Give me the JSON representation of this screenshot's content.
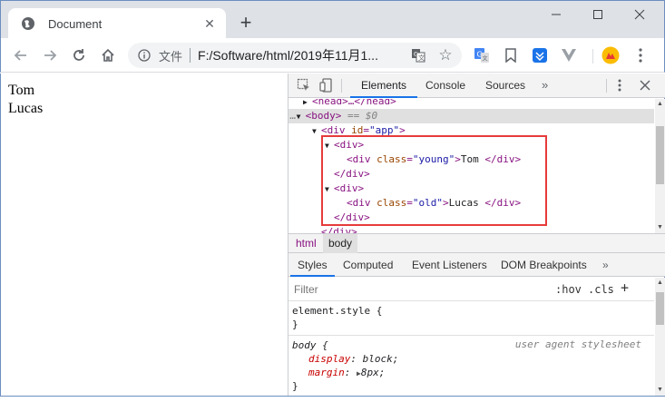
{
  "browser": {
    "tab_title": "Document",
    "new_tab_label": "+",
    "site_label": "文件",
    "url": "F:/Software/html/2019年11月1...",
    "icons": {
      "favicon": "globe-icon",
      "back": "back-arrow-icon",
      "forward": "forward-arrow-icon",
      "reload": "reload-icon",
      "home": "home-icon",
      "info": "info-icon",
      "translate": "translate-icon",
      "star": "star-icon",
      "menu": "kebab-menu-icon"
    }
  },
  "page": {
    "lines": [
      "Tom",
      "Lucas"
    ]
  },
  "devtools": {
    "tabs": [
      "Elements",
      "Console",
      "Sources"
    ],
    "active_tab": "Elements",
    "more_tabs": "»",
    "dom": {
      "head_line": "<head>…</head>",
      "body_open": "<body>",
      "body_marker": "== $0",
      "dots": "…",
      "app_div_tag": "div",
      "app_div_attr": "id",
      "app_div_val": "\"app\"",
      "div_open": "<div>",
      "div_close": "</div>",
      "young_attr": "class",
      "young_val": "\"young\"",
      "young_text": "Tom ",
      "old_attr": "class",
      "old_val": "\"old\"",
      "old_text": "Lucas ",
      "trailing": "</div>"
    },
    "breadcrumbs": [
      "html",
      "body"
    ],
    "style_tabs": [
      "Styles",
      "Computed",
      "Event Listeners",
      "DOM Breakpoints"
    ],
    "active_style_tab": "Styles",
    "filter_placeholder": "Filter",
    "hov_label": ":hov",
    "cls_label": ".cls",
    "add_label": "+",
    "element_style_selector": "element.style {",
    "close_brace": "}",
    "body_selector": "body {",
    "user_agent_label": "user agent stylesheet",
    "declarations": [
      {
        "prop": "display",
        "value": "block;"
      },
      {
        "prop": "margin",
        "value": "8px;"
      }
    ],
    "colors": {
      "highlight_box": "#e63b3b",
      "active_tab_underline": "#1a73e8",
      "tag": "#881280",
      "attr": "#994500",
      "attr_value": "#1a1aa6"
    }
  }
}
